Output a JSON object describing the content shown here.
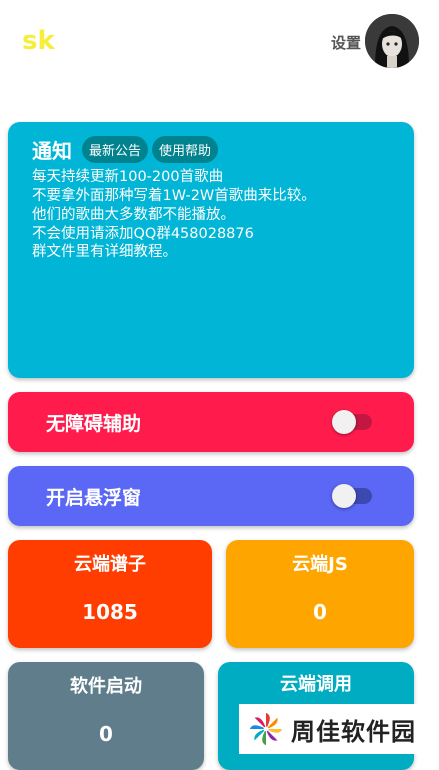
{
  "header": {
    "app_title": "sk",
    "settings_label": "设置"
  },
  "notice": {
    "title": "通知",
    "chips": [
      "最新公告",
      "使用帮助"
    ],
    "lines": [
      "每天持续更新100-200首歌曲",
      "不要拿外面那种写着1W-2W首歌曲来比较。",
      "他们的歌曲大多数都不能播放。",
      "不会使用请添加QQ群458028876",
      "群文件里有详细教程。"
    ]
  },
  "toggles": [
    {
      "label": "无障碍辅助",
      "checked": false,
      "color": "#ff1c4d"
    },
    {
      "label": "开启悬浮窗",
      "checked": false,
      "color": "#5b67f5"
    }
  ],
  "stats": [
    {
      "title": "云端谱子",
      "value": "1085",
      "color": "#ff3d00"
    },
    {
      "title": "云端JS",
      "value": "0",
      "color": "#ffa500"
    },
    {
      "title": "软件启动",
      "value": "0",
      "color": "#607d8b"
    },
    {
      "title": "云端调用",
      "value": "",
      "color": "#00acc1"
    }
  ],
  "watermark": {
    "text": "周佳软件园",
    "icon": "pinwheel-logo-icon"
  },
  "icons": {
    "avatar": "avatar-icon"
  }
}
